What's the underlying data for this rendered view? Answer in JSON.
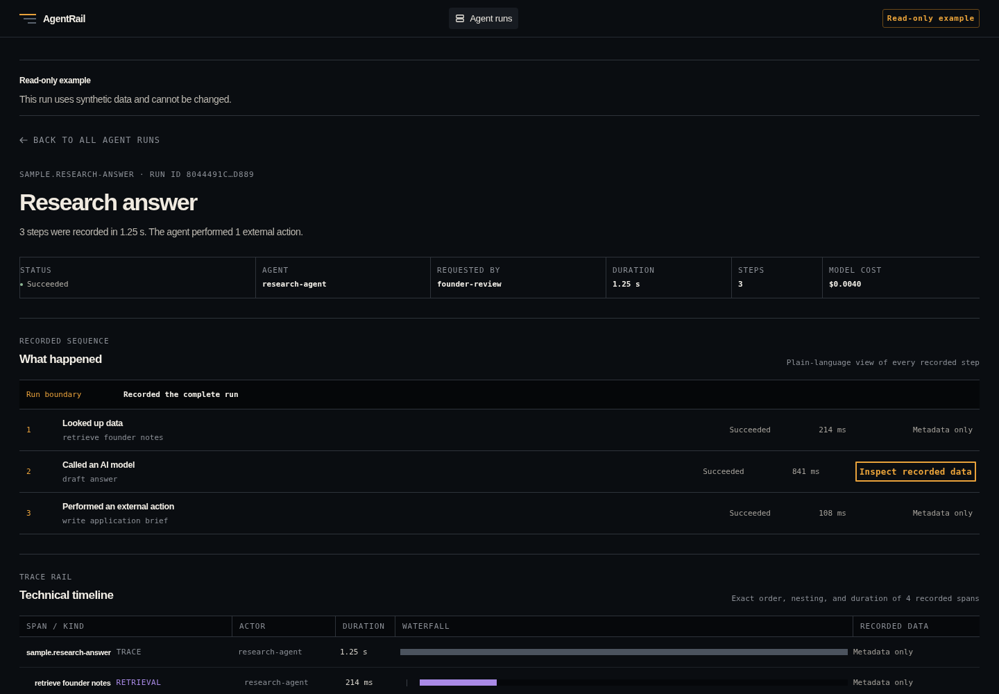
{
  "header": {
    "brand": "AgentRail",
    "nav_button": "Agent runs",
    "badge": "Read-only example"
  },
  "notice": {
    "title": "Read-only example",
    "text": "This run uses synthetic data and cannot be changed."
  },
  "back_link": "BACK TO ALL AGENT RUNS",
  "run": {
    "eyebrow": "SAMPLE.RESEARCH-ANSWER · RUN ID 8044491C…D889",
    "title": "Research answer",
    "summary": "3 steps were recorded in 1.25 s. The agent performed 1 external action."
  },
  "details": [
    {
      "label": "STATUS",
      "value": "Succeeded",
      "color": "#8fb996"
    },
    {
      "label": "AGENT",
      "value": "research-agent"
    },
    {
      "label": "REQUESTED BY",
      "value": "founder-review"
    },
    {
      "label": "DURATION",
      "value": "1.25 s"
    },
    {
      "label": "STEPS",
      "value": "3"
    },
    {
      "label": "MODEL COST",
      "value": "$0.0040"
    }
  ],
  "sequence": {
    "eyebrow": "RECORDED SEQUENCE",
    "title": "What happened",
    "caption": "Plain-language view of every recorded step",
    "boundary": {
      "label": "Run boundary",
      "text": "Recorded the complete run"
    },
    "steps": [
      {
        "number": "1",
        "title": "Looked up data",
        "name": "retrieve founder notes",
        "status": "Succeeded",
        "duration": "214 ms",
        "data": {
          "kind": "note",
          "label": "Metadata only"
        }
      },
      {
        "number": "2",
        "title": "Called an AI model",
        "name": "draft answer",
        "status": "Succeeded",
        "duration": "841 ms",
        "data": {
          "kind": "button",
          "label": "Inspect recorded data"
        }
      },
      {
        "number": "3",
        "title": "Performed an external action",
        "name": "write application brief",
        "status": "Succeeded",
        "duration": "108 ms",
        "data": {
          "kind": "note",
          "label": "Metadata only"
        }
      }
    ]
  },
  "timeline": {
    "eyebrow": "TRACE RAIL",
    "title": "Technical timeline",
    "caption": "Exact order, nesting, and duration of 4 recorded spans",
    "columns": [
      "SPAN / KIND",
      "ACTOR",
      "DURATION",
      "WATERFALL",
      "RECORDED DATA"
    ],
    "spans": [
      {
        "name": "sample.research-answer",
        "kind_label": "TRACE",
        "color": "#8a8f97",
        "actor": "research-agent",
        "duration": "1.25 s",
        "level": 1,
        "data": "Metadata only",
        "children": [
          {
            "name": "retrieve founder notes",
            "kind_label": "RETRIEVAL",
            "color": "#a98ae6",
            "actor": "research-agent",
            "duration": "214 ms",
            "level": 0.18,
            "data": "Metadata only"
          }
        ]
      }
    ]
  }
}
